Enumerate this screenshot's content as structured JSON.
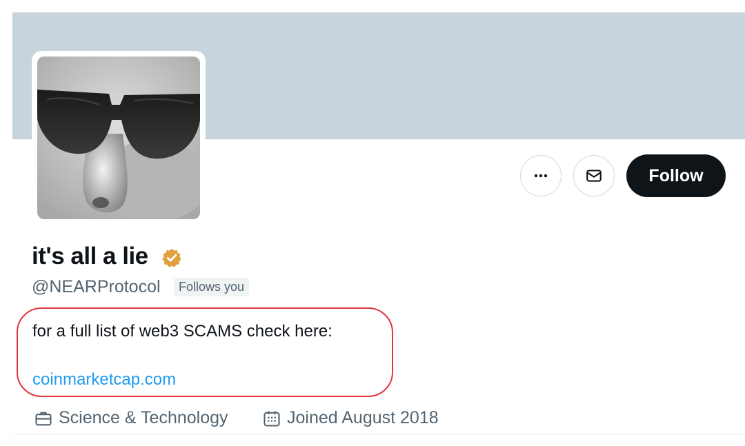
{
  "profile": {
    "display_name": "it's all a lie",
    "verified_badge_icon": "verified-badge-icon",
    "verified_color": "#e2a03f",
    "handle": "@NEARProtocol",
    "follows_you_label": "Follows you",
    "bio": {
      "text": "for a full list of web3 SCAMS check here:",
      "link": "coinmarketcap.com"
    },
    "category": "Science & Technology",
    "joined": "Joined August 2018"
  },
  "actions": {
    "more_icon": "more-icon",
    "message_icon": "mail-icon",
    "follow_label": "Follow"
  },
  "colors": {
    "banner": "#c7d4db",
    "follow_button": "#0f1419",
    "link": "#1d9bf0",
    "secondary_text": "#536471",
    "highlight": "#e0343c"
  }
}
